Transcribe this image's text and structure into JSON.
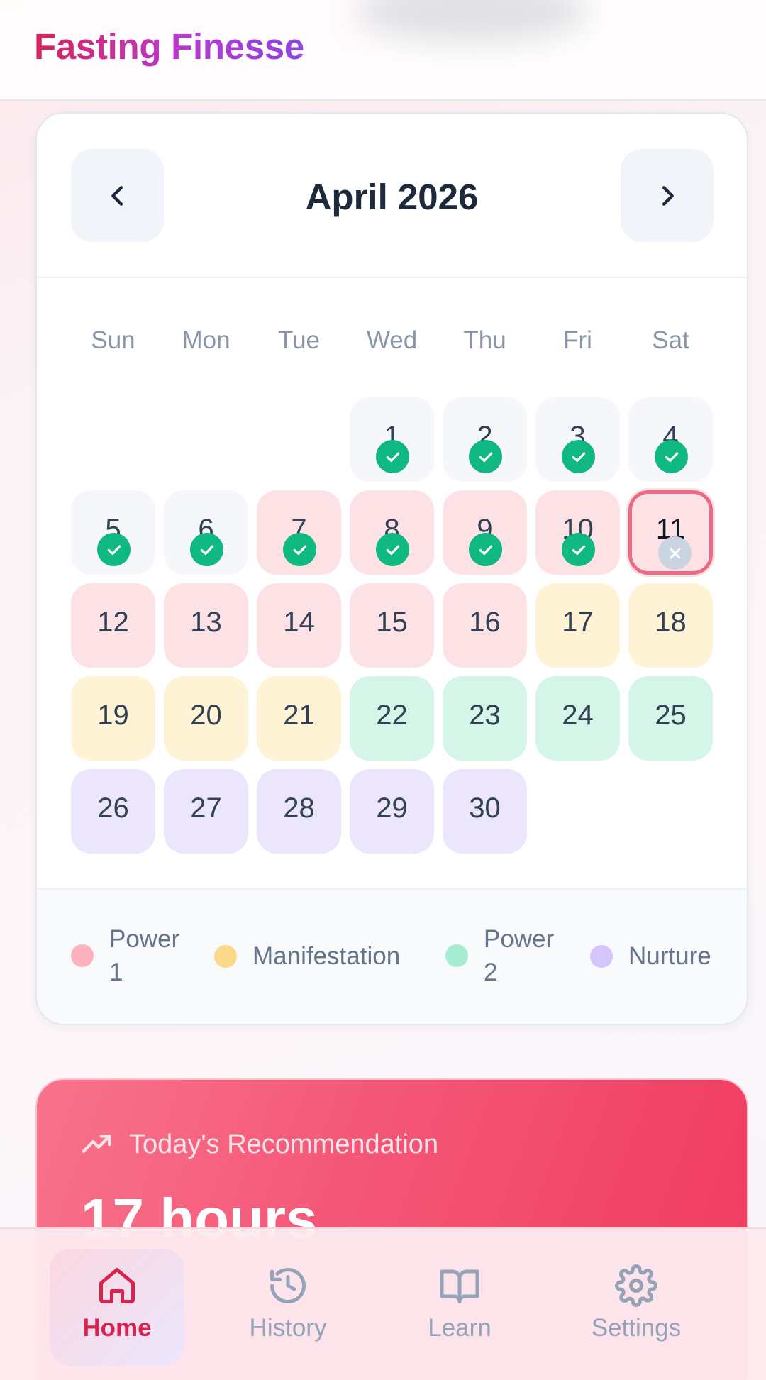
{
  "app": {
    "title": "Fasting Finesse"
  },
  "calendar": {
    "month_label": "April 2026",
    "prev_icon": "chevron-left-icon",
    "next_icon": "chevron-right-icon",
    "weekdays": [
      "Sun",
      "Mon",
      "Tue",
      "Wed",
      "Thu",
      "Fri",
      "Sat"
    ],
    "days": [
      {
        "n": "1",
        "phase": "neutral",
        "status": "done"
      },
      {
        "n": "2",
        "phase": "neutral",
        "status": "done"
      },
      {
        "n": "3",
        "phase": "neutral",
        "status": "done"
      },
      {
        "n": "4",
        "phase": "neutral",
        "status": "done"
      },
      {
        "n": "5",
        "phase": "neutral",
        "status": "done"
      },
      {
        "n": "6",
        "phase": "neutral",
        "status": "done"
      },
      {
        "n": "7",
        "phase": "power1",
        "status": "done"
      },
      {
        "n": "8",
        "phase": "power1",
        "status": "done"
      },
      {
        "n": "9",
        "phase": "power1",
        "status": "done"
      },
      {
        "n": "10",
        "phase": "power1",
        "status": "done"
      },
      {
        "n": "11",
        "phase": "power1",
        "status": "missed",
        "today": true
      },
      {
        "n": "12",
        "phase": "power1"
      },
      {
        "n": "13",
        "phase": "power1"
      },
      {
        "n": "14",
        "phase": "power1"
      },
      {
        "n": "15",
        "phase": "power1"
      },
      {
        "n": "16",
        "phase": "power1"
      },
      {
        "n": "17",
        "phase": "manif"
      },
      {
        "n": "18",
        "phase": "manif"
      },
      {
        "n": "19",
        "phase": "manif"
      },
      {
        "n": "20",
        "phase": "manif"
      },
      {
        "n": "21",
        "phase": "manif"
      },
      {
        "n": "22",
        "phase": "power2"
      },
      {
        "n": "23",
        "phase": "power2"
      },
      {
        "n": "24",
        "phase": "power2"
      },
      {
        "n": "25",
        "phase": "power2"
      },
      {
        "n": "26",
        "phase": "nurture"
      },
      {
        "n": "27",
        "phase": "nurture"
      },
      {
        "n": "28",
        "phase": "nurture"
      },
      {
        "n": "29",
        "phase": "nurture"
      },
      {
        "n": "30",
        "phase": "nurture"
      }
    ],
    "first_weekday": 3,
    "status_icons": {
      "done": "check-icon",
      "missed": "x-icon"
    }
  },
  "legend": [
    {
      "label": "Power 1",
      "color": "#fcb3bf",
      "lines": [
        "Power",
        "1"
      ]
    },
    {
      "label": "Manifestation",
      "color": "#fcd98a",
      "lines": [
        "Manifestation"
      ]
    },
    {
      "label": "Power 2",
      "color": "#a5ecd0",
      "lines": [
        "Power",
        "2"
      ]
    },
    {
      "label": "Nurture",
      "color": "#d4c6fb",
      "lines": [
        "Nurture"
      ]
    }
  ],
  "recommendation": {
    "icon": "trending-up-icon",
    "label": "Today's Recommendation",
    "value": "17 hours"
  },
  "nav": [
    {
      "label": "Home",
      "icon": "home-icon",
      "active": true
    },
    {
      "label": "History",
      "icon": "history-icon",
      "active": false
    },
    {
      "label": "Learn",
      "icon": "book-icon",
      "active": false
    },
    {
      "label": "Settings",
      "icon": "gear-icon",
      "active": false
    }
  ],
  "colors": {
    "accent": "#d9234f",
    "done": "#10b981",
    "missed": "#cbd5e1",
    "today_border": "#ec6a84"
  }
}
